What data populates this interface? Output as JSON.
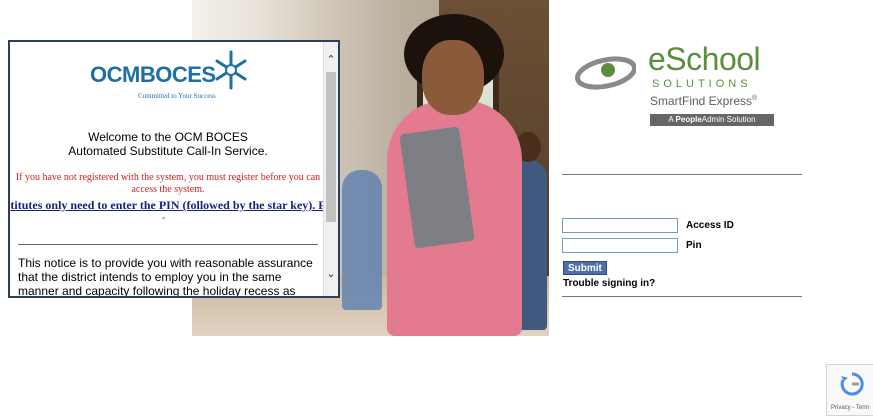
{
  "notice_panel": {
    "logo_text": "OCMBOCES",
    "logo_tagline": "Committed to Your Success",
    "welcome_line1": "Welcome to the OCM BOCES",
    "welcome_line2": "Automated Substitute Call-In Service.",
    "register_warning_line1": "If you have not registered with the system, you must register before you can",
    "register_warning_line2": "access the system.",
    "marquee_text": "titutes only need to enter the PIN (followed by the star key). F",
    "dot": "-",
    "notice_text": "This notice is to provide you with reasonable assurance that the district intends to employ you in the same manner and capacity following the holiday recess as employed"
  },
  "brand": {
    "title": "eSchool",
    "subtitle": "SOLUTIONS",
    "product": "SmartFind Express",
    "product_mark": "®",
    "tagline_bold": "People",
    "tagline_prefix": "A ",
    "tagline_suffix": "Admin Solution"
  },
  "login": {
    "access_id_label": "Access ID",
    "access_id_value": "",
    "pin_label": "Pin",
    "pin_value": "",
    "submit_label": "Submit",
    "trouble_label": "Trouble signing in?"
  },
  "recaptcha": {
    "text": "Privacy - Term"
  },
  "colors": {
    "brand_green": "#5c8e3e",
    "ocm_blue": "#1d6fa5",
    "warning_red": "#cc1f1f",
    "submit_blue": "#4f6fa8"
  }
}
